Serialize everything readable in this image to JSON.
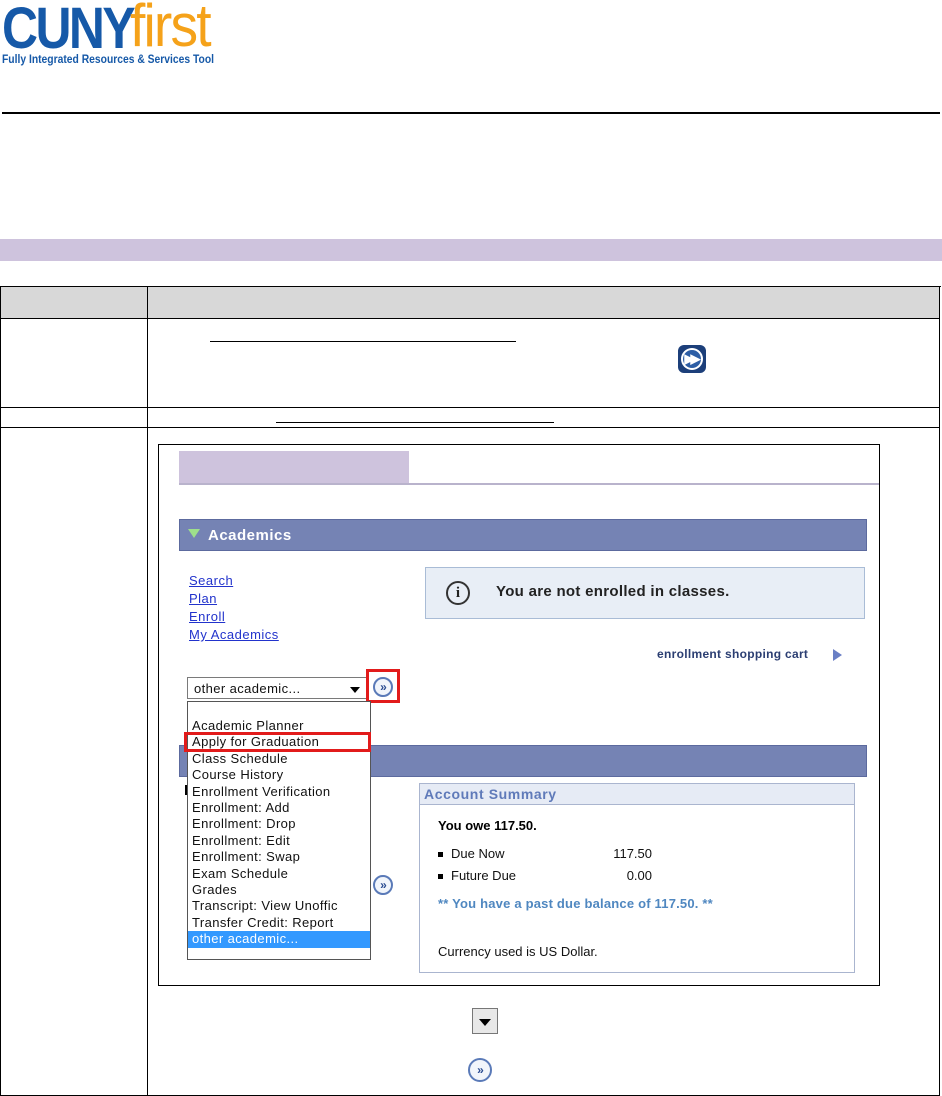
{
  "header": {
    "logo_cuny": "CUNY",
    "logo_first": "first",
    "logo_tagline": "Fully Integrated Resources & Services Tool"
  },
  "screenshot": {
    "academics_title": "Academics",
    "links": [
      "Search",
      "Plan",
      "Enroll",
      "My Academics"
    ],
    "info_message": "You are not enrolled in classes.",
    "cart_link": "enrollment shopping cart",
    "select_value": "other academic...",
    "dropdown_options": [
      "Academic Planner",
      "Apply for Graduation",
      "Class Schedule",
      "Course History",
      "Enrollment Verification",
      "Enrollment: Add",
      "Enrollment: Drop",
      "Enrollment: Edit",
      "Enrollment: Swap",
      "Exam Schedule",
      "Grades",
      "Transcript: View Unoffic",
      "Transfer Credit: Report",
      "other academic..."
    ],
    "account_summary": {
      "title": "Account Summary",
      "owe": "You owe 117.50.",
      "due_now_label": "Due Now",
      "due_now_amount": "117.50",
      "future_due_label": "Future Due",
      "future_due_amount": "0.00",
      "warning": "** You have a past due balance of 117.50. **",
      "currency": "Currency used is US Dollar."
    }
  },
  "colors": {
    "accent_purple": "#cec3dd",
    "pagelet_bar": "#7583b4",
    "highlight_red": "#e21b1b",
    "selection_blue": "#3399ff"
  }
}
